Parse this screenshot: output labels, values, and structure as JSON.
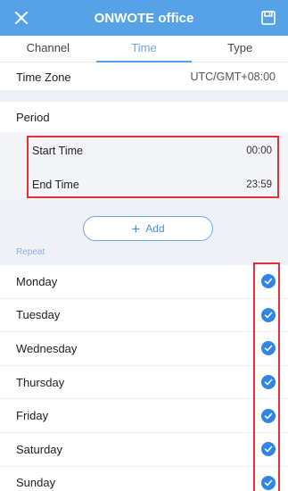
{
  "header": {
    "title": "ONWOTE office",
    "close_icon": "close-icon",
    "save_icon": "save-icon",
    "bar_color": "#55a2e6"
  },
  "tabs": [
    {
      "label": "Channel",
      "active": false
    },
    {
      "label": "Time",
      "active": true
    },
    {
      "label": "Type",
      "active": false
    }
  ],
  "time_zone": {
    "label": "Time Zone",
    "value": "UTC/GMT+08:00"
  },
  "period": {
    "label": "Period",
    "start_label": "Start Time",
    "start_value": "00:00",
    "end_label": "End Time",
    "end_value": "23:59"
  },
  "add_button": {
    "label": "Add"
  },
  "repeat": {
    "label": "Repeat",
    "days": [
      {
        "label": "Monday",
        "checked": true
      },
      {
        "label": "Tuesday",
        "checked": true
      },
      {
        "label": "Wednesday",
        "checked": true
      },
      {
        "label": "Thursday",
        "checked": true
      },
      {
        "label": "Friday",
        "checked": true
      },
      {
        "label": "Saturday",
        "checked": true
      },
      {
        "label": "Sunday",
        "checked": true
      }
    ]
  },
  "highlight_color": "#e0303a",
  "check_color": "#2f86e8"
}
